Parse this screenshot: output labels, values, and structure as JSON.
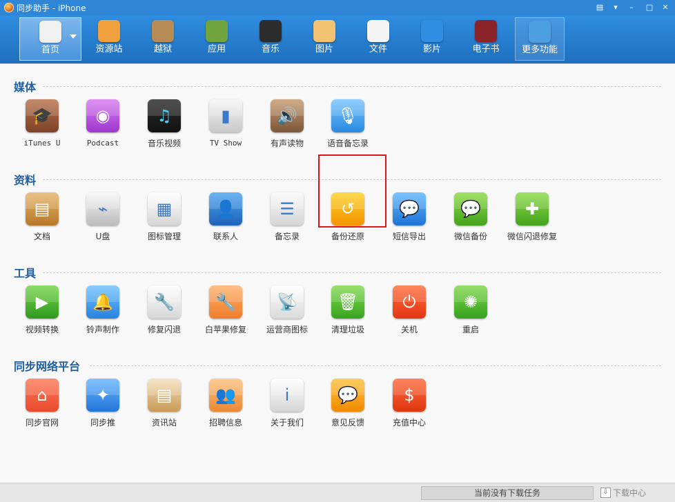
{
  "window": {
    "title": "同步助手 - iPhone"
  },
  "window_controls": [
    {
      "name": "message-icon",
      "symbol": "▤"
    },
    {
      "name": "menu-icon",
      "symbol": "▾"
    },
    {
      "name": "minimize-icon",
      "symbol": "–"
    },
    {
      "name": "maximize-icon",
      "symbol": "□"
    },
    {
      "name": "close-icon",
      "symbol": "✕"
    }
  ],
  "nav": [
    {
      "label": "首页",
      "icon": "home-icon",
      "active": true
    },
    {
      "label": "资源站",
      "icon": "bag-icon"
    },
    {
      "label": "越狱",
      "icon": "jailbreak-icon"
    },
    {
      "label": "应用",
      "icon": "apps-icon"
    },
    {
      "label": "音乐",
      "icon": "music-icon"
    },
    {
      "label": "图片",
      "icon": "photo-icon"
    },
    {
      "label": "文件",
      "icon": "file-icon"
    },
    {
      "label": "影片",
      "icon": "video-icon"
    },
    {
      "label": "电子书",
      "icon": "ebook-icon"
    },
    {
      "label": "更多功能",
      "icon": "more-tools-icon",
      "more": true
    }
  ],
  "sections": [
    {
      "title": "媒体",
      "items": [
        {
          "label": "iTunes U",
          "icon": "itunes-u-icon",
          "colors": [
            "#b8734c",
            "#7d4229"
          ],
          "glyph": "🎓"
        },
        {
          "label": "Podcast",
          "icon": "podcast-icon",
          "colors": [
            "#d97cf1",
            "#9c38ce"
          ],
          "glyph": "◉"
        },
        {
          "label": "音乐视频",
          "icon": "music-video-icon",
          "colors": [
            "#2d2d2d",
            "#111"
          ],
          "glyph": "♫"
        },
        {
          "label": "TV Show",
          "icon": "tv-show-icon",
          "colors": [
            "#f5f5f5",
            "#c8c8c8"
          ],
          "glyph": "▮"
        },
        {
          "label": "有声读物",
          "icon": "audiobook-icon",
          "colors": [
            "#c79b71",
            "#7b5739"
          ],
          "glyph": "🔊"
        },
        {
          "label": "语音备忘录",
          "icon": "voice-memo-icon",
          "colors": [
            "#79c5ff",
            "#2989df"
          ],
          "glyph": "🎙"
        }
      ]
    },
    {
      "title": "资料",
      "items": [
        {
          "label": "文档",
          "icon": "document-icon",
          "colors": [
            "#e7b56b",
            "#b7792c"
          ],
          "glyph": "▤"
        },
        {
          "label": "U盘",
          "icon": "usb-drive-icon",
          "colors": [
            "#f7f7f7",
            "#bcbcbc"
          ],
          "glyph": "⌁"
        },
        {
          "label": "图标管理",
          "icon": "icon-manager-icon",
          "colors": [
            "#ffffff",
            "#d6d6d6"
          ],
          "glyph": "▦"
        },
        {
          "label": "联系人",
          "icon": "contacts-icon",
          "colors": [
            "#4da4ef",
            "#1f63bb"
          ],
          "glyph": "👤"
        },
        {
          "label": "备忘录",
          "icon": "memo-icon",
          "colors": [
            "#fafafa",
            "#d5d5d5"
          ],
          "glyph": "☰"
        },
        {
          "label": "备份还原",
          "icon": "backup-restore-icon",
          "colors": [
            "#ffd12a",
            "#f39400"
          ],
          "glyph": "↺"
        },
        {
          "label": "短信导出",
          "icon": "sms-export-icon",
          "colors": [
            "#61b8ff",
            "#1f73d6"
          ],
          "glyph": "💬"
        },
        {
          "label": "微信备份",
          "icon": "wechat-backup-icon",
          "colors": [
            "#8ddb46",
            "#45a31f"
          ],
          "glyph": "💬"
        },
        {
          "label": "微信闪退修复",
          "icon": "wechat-fix-icon",
          "colors": [
            "#8ddb46",
            "#45a31f"
          ],
          "glyph": "✚"
        }
      ]
    },
    {
      "title": "工具",
      "items": [
        {
          "label": "视频转换",
          "icon": "video-convert-icon",
          "colors": [
            "#78d44d",
            "#2f9a1d"
          ],
          "glyph": "▶"
        },
        {
          "label": "铃声制作",
          "icon": "ringtone-icon",
          "colors": [
            "#73c4ff",
            "#2782df"
          ],
          "glyph": "🔔"
        },
        {
          "label": "修复闪退",
          "icon": "repair-crash-icon",
          "colors": [
            "#fdfdfd",
            "#d7d7d7"
          ],
          "glyph": "🔧"
        },
        {
          "label": "白苹果修复",
          "icon": "white-apple-fix-icon",
          "colors": [
            "#ffb16d",
            "#ef7d2b"
          ],
          "glyph": "🔧"
        },
        {
          "label": "运营商图标",
          "icon": "carrier-icon",
          "colors": [
            "#ffffff",
            "#d9d9d9"
          ],
          "glyph": "📡"
        },
        {
          "label": "清理垃圾",
          "icon": "trash-icon",
          "colors": [
            "#83db50",
            "#38a31f"
          ],
          "glyph": "🗑"
        },
        {
          "label": "关机",
          "icon": "power-icon",
          "colors": [
            "#ff6e3e",
            "#e33613"
          ],
          "glyph": "⏻"
        },
        {
          "label": "重启",
          "icon": "restart-icon",
          "colors": [
            "#7fd84b",
            "#36a11e"
          ],
          "glyph": "✺"
        }
      ]
    },
    {
      "title": "同步网络平台",
      "items": [
        {
          "label": "同步官网",
          "icon": "official-site-icon",
          "colors": [
            "#ff7859",
            "#e84a2d"
          ],
          "glyph": "⌂"
        },
        {
          "label": "同步推",
          "icon": "sync-push-icon",
          "colors": [
            "#67b7ff",
            "#2375d9"
          ],
          "glyph": "✦"
        },
        {
          "label": "资讯站",
          "icon": "news-icon",
          "colors": [
            "#f3e0bd",
            "#c99a56"
          ],
          "glyph": "▤"
        },
        {
          "label": "招聘信息",
          "icon": "recruitment-icon",
          "colors": [
            "#ffc07e",
            "#e98a35"
          ],
          "glyph": "👥"
        },
        {
          "label": "关于我们",
          "icon": "about-icon",
          "colors": [
            "#ffffff",
            "#d5d5d5"
          ],
          "glyph": "i"
        },
        {
          "label": "意见反馈",
          "icon": "feedback-icon",
          "colors": [
            "#ffc23f",
            "#f08b00"
          ],
          "glyph": "💬"
        },
        {
          "label": "充值中心",
          "icon": "recharge-icon",
          "colors": [
            "#ff6b3e",
            "#df3610"
          ],
          "glyph": "$"
        }
      ]
    }
  ],
  "status": {
    "download_status": "当前没有下载任务",
    "download_center": "下载中心"
  }
}
